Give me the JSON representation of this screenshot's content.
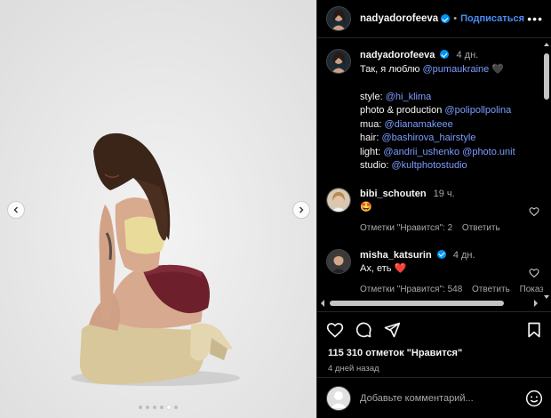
{
  "post": {
    "username": "nadyadorofeeva",
    "follow_label": "Подписаться",
    "more_label": "•••"
  },
  "caption": {
    "username": "nadyadorofeeva",
    "time": "4 дн.",
    "text": "Так, я люблю",
    "tag_puma": "@pumaukraine",
    "heart": "🖤",
    "style_label": "style:",
    "style_tag": "@hi_klima",
    "photo_label": "photo & production",
    "photo_tag": "@polipollpolina",
    "mua_label": "mua:",
    "mua_tag": "@dianamakeee",
    "hair_label": "hair:",
    "hair_tag": "@bashirova_hairstyle",
    "light_label": "light:",
    "light_tag1": "@andrii_ushenko",
    "light_tag2": "@photo.unit",
    "studio_label": "studio:",
    "studio_tag": "@kultphotostudio"
  },
  "comments": [
    {
      "username": "bibi_schouten",
      "time": "19 ч.",
      "text": "🤩",
      "likes": "Отметки \"Нравится\": 2",
      "reply": "Ответить"
    },
    {
      "username": "misha_katsurin",
      "time": "4 дн.",
      "text": "Ах, еть",
      "emoji": "❤️",
      "likes": "Отметки \"Нравится\": 548",
      "reply": "Ответить",
      "extra": "Показать"
    }
  ],
  "footer": {
    "likes": "115 310 отметок \"Нравится\"",
    "ago": "4 дней назад",
    "add_comment_placeholder": "Добавьте комментарий..."
  },
  "carousel": {
    "total": 6,
    "active_index": 4
  },
  "colors": {
    "accent": "#0095f6",
    "tag": "#7c9cff",
    "muted": "#a8a8a8",
    "like_red": "#ed4956"
  }
}
